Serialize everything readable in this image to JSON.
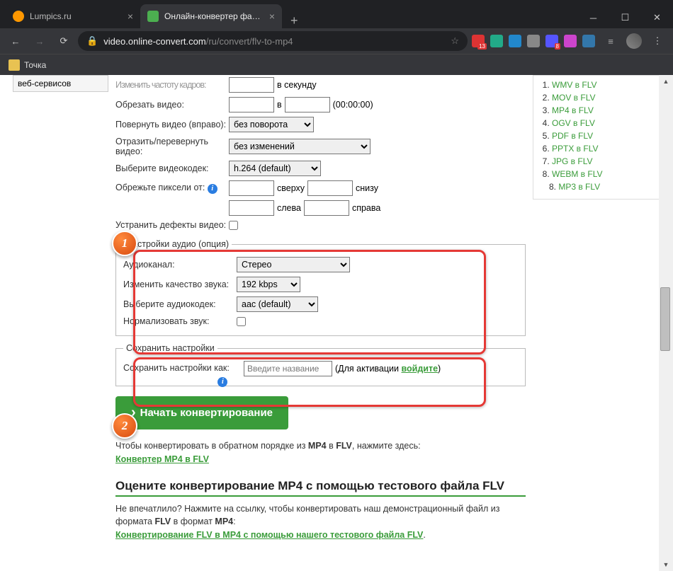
{
  "tabs": [
    {
      "title": "Lumpics.ru"
    },
    {
      "title": "Онлайн-конвертер файлов FLV"
    }
  ],
  "url": {
    "domain": "video.online-convert.com",
    "path": "/ru/convert/flv-to-mp4"
  },
  "bookmark": {
    "label": "Точка"
  },
  "ext_badges": {
    "b1": "13",
    "b2": "8"
  },
  "left_sidebar": {
    "label": "веб-сервисов"
  },
  "form": {
    "fps_label": "—————— ———— ——————:",
    "fps_suffix": "в секунду",
    "crop_label": "Обрезать видео:",
    "crop_sep": "в",
    "crop_hint": "(00:00:00)",
    "rotate_label": "Повернуть видео (вправо):",
    "rotate_value": "без поворота",
    "flip_label": "Отразить/перевернуть видео:",
    "flip_value": "без изменений",
    "vcodec_label": "Выберите видеокодек:",
    "vcodec_value": "h.264 (default)",
    "pxcrop_label": "Обрежьте пиксели от:",
    "px_top": "сверху",
    "px_bottom": "снизу",
    "px_left": "слева",
    "px_right": "справа",
    "defects_label": "Устранить дефекты видео:"
  },
  "audio": {
    "legend": "Настройки аудио (опция)",
    "channel_label": "Аудиоканал:",
    "channel_value": "Стерео",
    "quality_label": "Изменить качество звука:",
    "quality_value": "192 kbps",
    "acodec_label": "Выберите аудиокодек:",
    "acodec_value": "aac (default)",
    "normalize_label": "Нормализовать звук:"
  },
  "save": {
    "legend": "Сохранить настройки",
    "label": "Сохранить настройки как:",
    "placeholder": "Введите название",
    "hint_prefix": "(Для активации ",
    "hint_link": "войдите",
    "hint_suffix": ")"
  },
  "start_btn": "Начать конвертирование",
  "reverse": {
    "text_pre": "Чтобы конвертировать в обратном порядке из ",
    "b1": "MP4",
    "mid": " в ",
    "b2": "FLV",
    "text_post": ", нажмите здесь:",
    "link": "Конвертер MP4 в FLV"
  },
  "rate_heading": "Оцените конвертирование MP4 с помощью тестового файла FLV",
  "demo": {
    "line_pre": "Не впечатлило? Нажмите на ссылку, чтобы конвертировать наш демонстрационный файл из формата ",
    "b1": "FLV",
    "mid": " в формат ",
    "b2": "MP4",
    "post": ":",
    "link": "Конвертирование FLV в MP4 с помощью нашего тестового файла FLV",
    "dot": "."
  },
  "right_links": [
    "WMV в FLV",
    "MOV в FLV",
    "MP4 в FLV",
    "OGV в FLV",
    "PDF в FLV",
    "PPTX в FLV",
    "JPG в FLV",
    "WEBM в FLV",
    "MP3 в FLV"
  ],
  "badges": {
    "n1": "1",
    "n2": "2"
  }
}
